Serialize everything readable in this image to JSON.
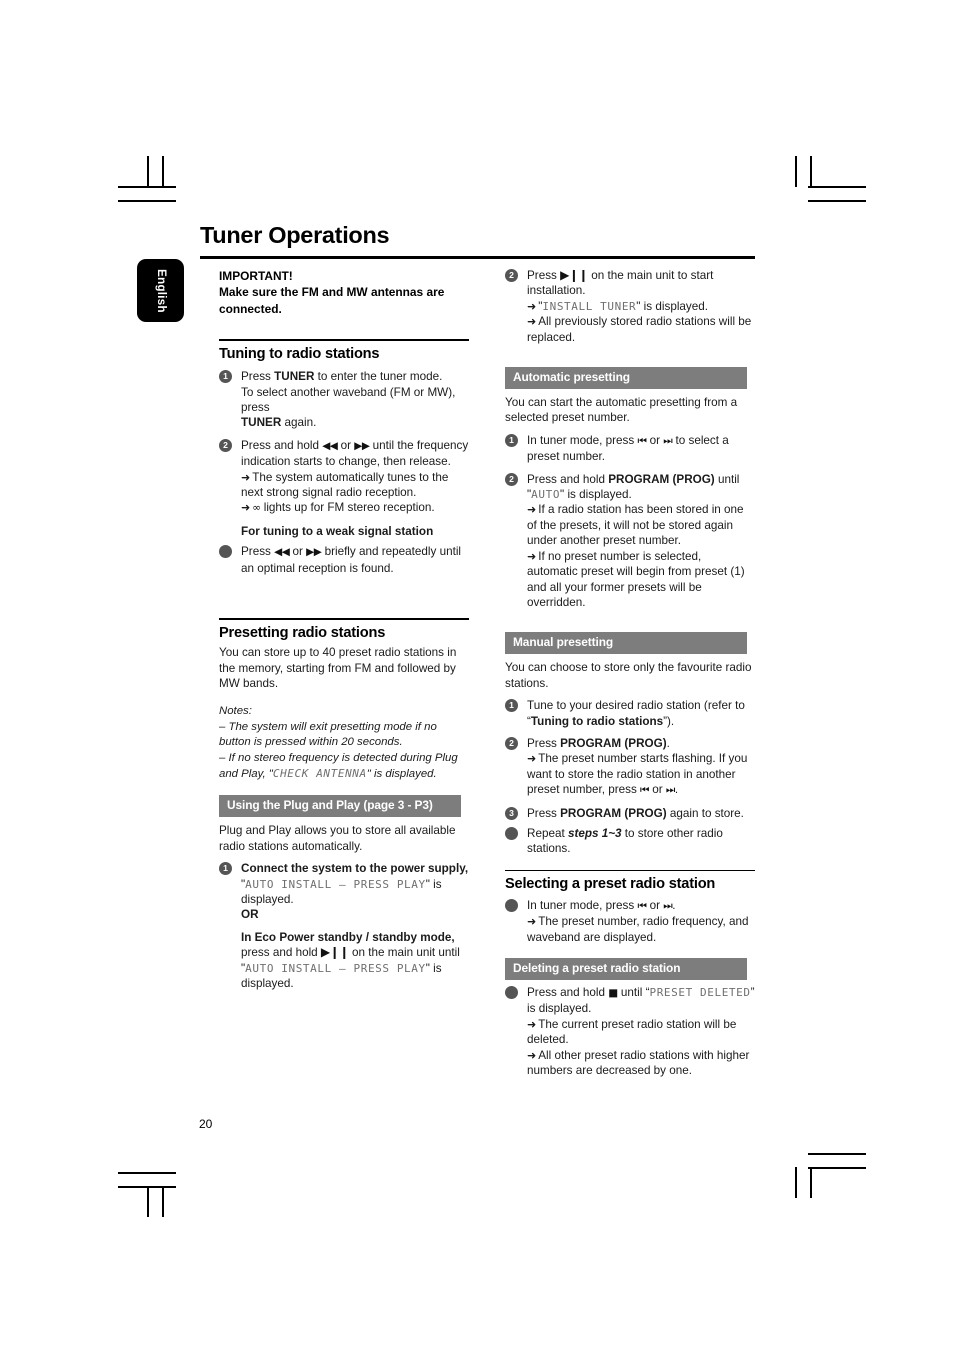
{
  "document": {
    "title": "Tuner Operations",
    "language_tab": "English",
    "page_number": "20"
  },
  "glyphs": {
    "prev_track": "⏮",
    "next_track": "⏭",
    "rewind": "◀◀",
    "forward": "▶▶",
    "play_pause": "▶❙❙",
    "stop": "■",
    "stereo": "∞",
    "arrow": "➜"
  },
  "left_column": {
    "important": {
      "line1": "IMPORTANT!",
      "line2": "Make sure the FM and MW antennas are",
      "line3": "connected."
    },
    "tuning_section": {
      "heading": "Tuning to radio stations",
      "step1": {
        "number": "1",
        "line1_a": "Press ",
        "line1_b": "TUNER",
        "line1_c": " to enter the tuner mode.",
        "line2": "To select another waveband (FM or MW), press",
        "line3_a": "TUNER",
        "line3_b": " again."
      },
      "step2": {
        "number": "2",
        "line1_a": "Press and hold ",
        "line1_b": " or ",
        "line1_c": " until the frequency",
        "line2": "indication starts to change, then release.",
        "arrow1": "The system automatically tunes to the next strong signal radio reception.",
        "arrow2_b": " lights up for FM stereo reception."
      },
      "weak_signal": {
        "heading": "For tuning to a weak signal station",
        "line_a": "Press ",
        "line_b": " or ",
        "line_c": " briefly and repeatedly until an optimal reception is found."
      }
    },
    "presetting_section": {
      "heading": "Presetting radio stations",
      "intro": "You can store up to 40 preset radio stations in the memory, starting from FM and followed by MW bands.",
      "notes_label": "Notes:",
      "note1": "–  The system will exit presetting mode if no button is pressed within 20 seconds.",
      "note2_a": "–  If no stereo frequency is detected during Plug and Play, \"",
      "note2_lcd": "CHECK ANTENNA",
      "note2_b": "\" is displayed.",
      "plug_play_bar": "Using the Plug and Play (page 3 - P3)",
      "plug_play_intro": "Plug and Play allows you to store all available radio stations automatically.",
      "step1": {
        "number": "1",
        "line1": "Connect the system to the power supply,",
        "lcd1": "AUTO INSTALL – PRESS PLAY",
        "lcd1_suffix": " is displayed.",
        "or": "OR",
        "line2": "In Eco Power standby / standby mode,",
        "line3_a": "press and hold ",
        "line3_b": " on the main unit until",
        "lcd2": "AUTO INSTALL – PRESS PLAY",
        "lcd2_suffix": " is displayed."
      }
    }
  },
  "right_column": {
    "plug_play_step2": {
      "number": "2",
      "line1_a": "Press ",
      "line1_b": " on the main unit to start installation.",
      "arrow1_lcd": "INSTALL TUNER",
      "arrow1_suffix": " is displayed.",
      "arrow2": "All previously stored radio stations will be replaced."
    },
    "automatic_presetting": {
      "bar": "Automatic presetting",
      "intro": "You can start the automatic presetting from a selected preset number.",
      "step1": {
        "number": "1",
        "line_a": "In tuner mode, press ",
        "line_b": " or ",
        "line_c": " to select a preset number."
      },
      "step2": {
        "number": "2",
        "line1_a": "Press and hold ",
        "line1_b": "PROGRAM (PROG)",
        "line1_c": " until \"",
        "line1_lcd": "AUTO",
        "line1_d": "\" is displayed.",
        "arrow1": "If a radio station has been stored in one of the presets, it will not be stored again under another preset number.",
        "arrow2": "If no preset number is selected, automatic preset will begin from preset (1) and all your former presets will be overridden."
      }
    },
    "manual_presetting": {
      "bar": "Manual presetting",
      "intro": "You can choose to store only the favourite radio stations.",
      "step1": {
        "number": "1",
        "line_a": "Tune to your desired radio station (refer to “",
        "line_b": "Tuning to radio stations",
        "line_c": "”)."
      },
      "step2": {
        "number": "2",
        "line1_a": "Press ",
        "line1_b": "PROGRAM (PROG)",
        "line1_c": ".",
        "arrow1_a": "The preset number starts flashing. If you want to store the radio station in another preset number, press ",
        "arrow1_b": " or ",
        "arrow1_c": "."
      },
      "step3": {
        "number": "3",
        "line_a": "Press ",
        "line_b": "PROGRAM (PROG)",
        "line_c": " again to store."
      },
      "repeat": {
        "line_a": "Repeat ",
        "line_b": "steps 1~3",
        "line_c": " to store other radio stations."
      }
    },
    "selecting_preset": {
      "heading": "Selecting a preset radio station",
      "bullet": {
        "line_a": "In tuner mode, press ",
        "line_b": " or ",
        "line_c": ".",
        "arrow1": "The preset number, radio frequency, and waveband are displayed."
      }
    },
    "deleting_preset": {
      "bar": "Deleting a preset radio station",
      "bullet": {
        "line_a": "Press and hold ",
        "line_b": " until “",
        "line_lcd": "PRESET DELETED",
        "line_c": "” is displayed.",
        "arrow1": "The current preset radio station will be deleted.",
        "arrow2": "All other preset radio stations with higher numbers are decreased by one."
      }
    }
  }
}
